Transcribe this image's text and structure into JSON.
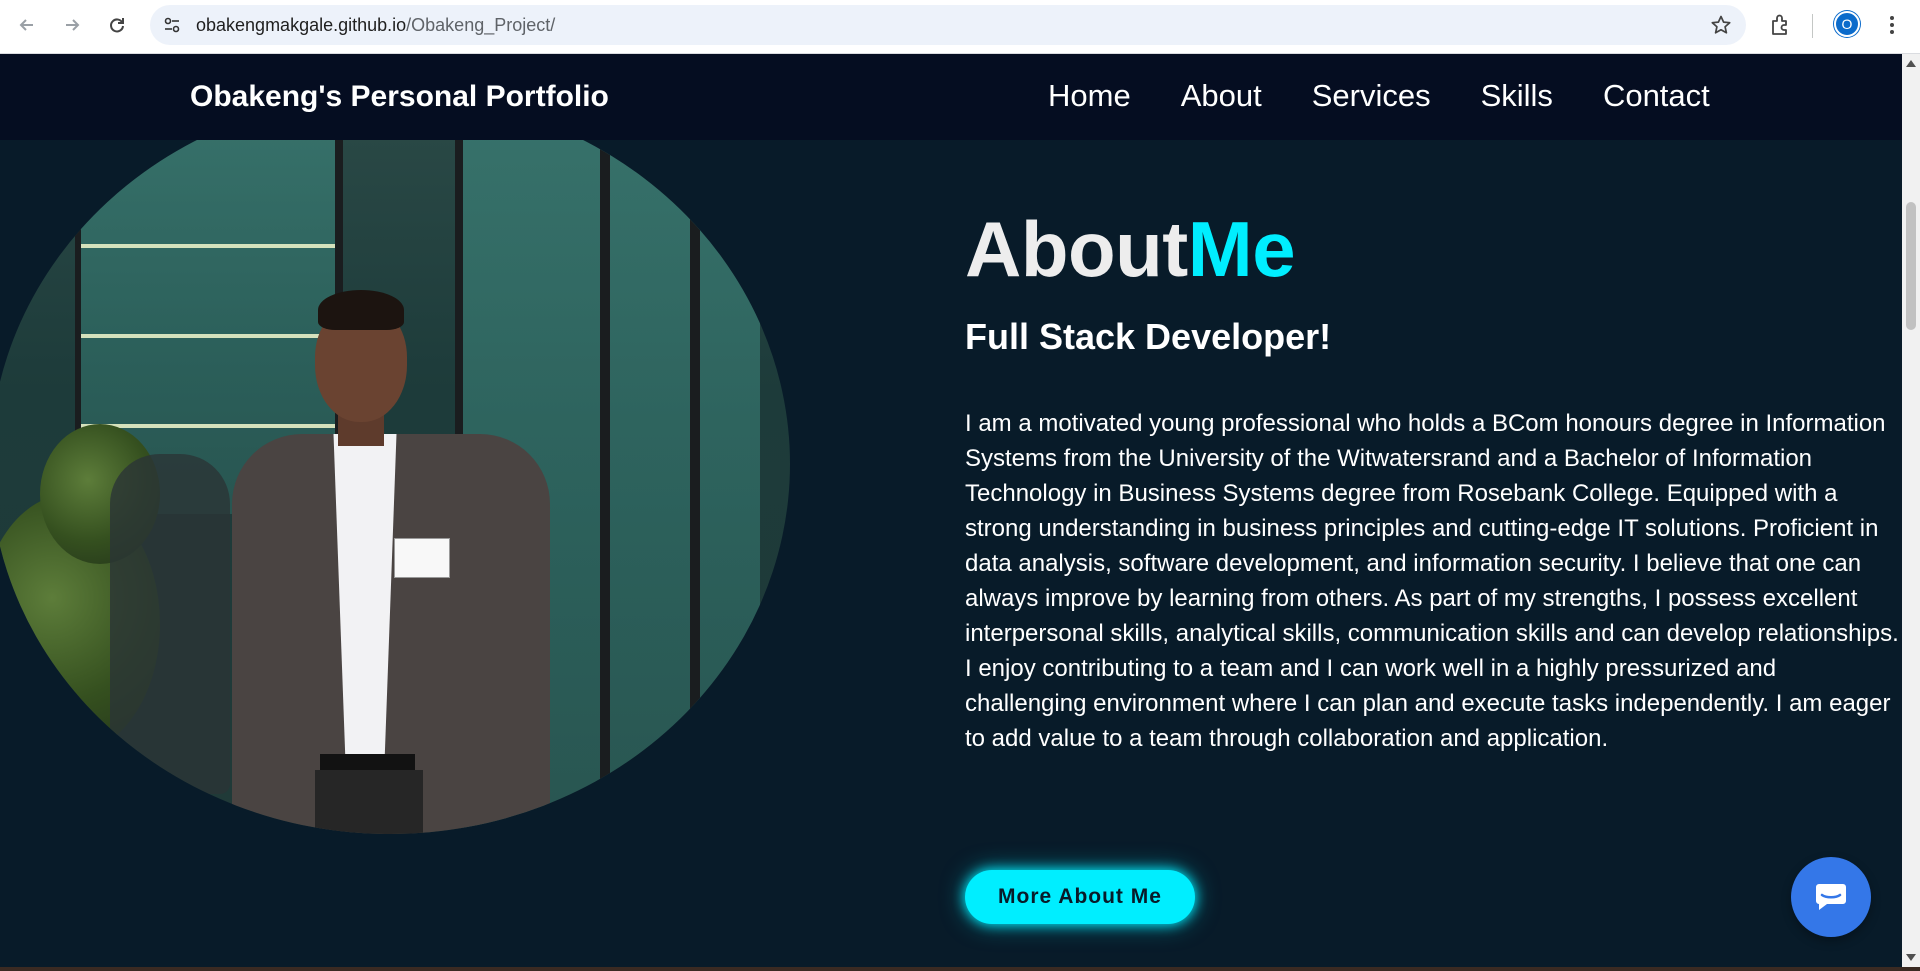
{
  "browser": {
    "url_host": "obakengmakgale.github.io",
    "url_path": "/Obakeng_Project/",
    "profile_initial": "O",
    "icons": [
      "back-icon",
      "forward-icon",
      "reload-icon",
      "site-info-icon",
      "bookmark-star-icon",
      "extensions-icon",
      "menu-icon"
    ]
  },
  "header": {
    "logo": "Obakeng's Personal Portfolio",
    "nav": [
      "Home",
      "About",
      "Services",
      "Skills",
      "Contact"
    ]
  },
  "about": {
    "title_main": "About",
    "title_accent": "Me",
    "subtitle": "Full Stack Developer!",
    "bio": "I am a motivated young professional who holds a BCom honours degree in Information Systems from the University of the Witwatersrand and a Bachelor of Information Technology in Business Systems degree from Rosebank College. Equipped with a strong understanding in business principles and cutting-edge IT solutions. Proficient in data analysis, software development, and information security. I believe that one can always improve by learning from others. As part of my strengths, I possess excellent interpersonal skills, analytical skills, communication skills and can develop relationships. I enjoy contributing to a team and I can work well in a highly pressurized and challenging environment where I can plan and execute tasks independently. I am eager to add value to a team through collaboration and application.",
    "button": "More About Me"
  },
  "colors": {
    "page_bg": "#081b29",
    "header_bg": "#050d21",
    "accent": "#00eeff",
    "chat_button": "#3477e8"
  }
}
